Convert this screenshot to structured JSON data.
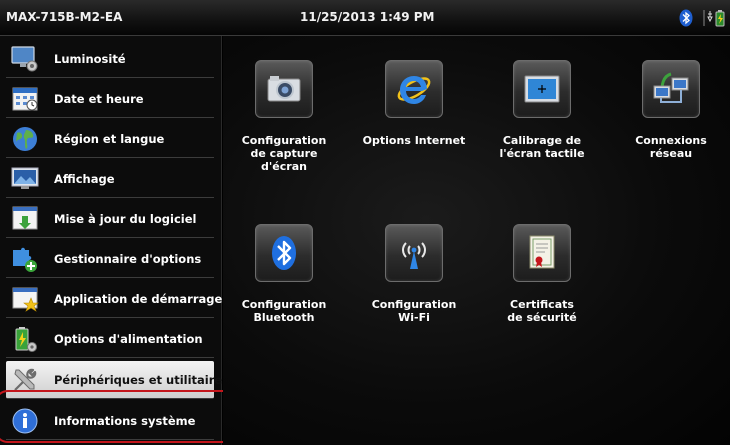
{
  "titlebar": {
    "device": "MAX-715B-M2-EA",
    "datetime": "11/25/2013 1:49 PM",
    "icons": [
      "bluetooth-icon",
      "power-battery-icon"
    ]
  },
  "sidebar": {
    "items": [
      {
        "label": "Luminosité",
        "icon": "monitor-brightness-icon"
      },
      {
        "label": "Date et heure",
        "icon": "calendar-icon"
      },
      {
        "label": "Région et langue",
        "icon": "globe-icon"
      },
      {
        "label": "Affichage",
        "icon": "display-icon"
      },
      {
        "label": "Mise à jour du logiciel",
        "icon": "software-update-icon"
      },
      {
        "label": "Gestionnaire d'options",
        "icon": "puzzle-options-icon"
      },
      {
        "label": "Application de démarrage",
        "icon": "startup-app-icon"
      },
      {
        "label": "Options d'alimentation",
        "icon": "battery-icon"
      },
      {
        "label": "Périphériques et utilitaires",
        "icon": "tools-icon",
        "selected": true
      },
      {
        "label": "Informations système",
        "icon": "info-icon"
      }
    ],
    "selected_color": "#e8e8e8",
    "highlight_color": "#c4161c"
  },
  "main": {
    "tiles": [
      {
        "label": "Configuration\nde capture\nd'écran",
        "icon": "camera-icon"
      },
      {
        "label": "Options Internet",
        "icon": "internet-explorer-icon"
      },
      {
        "label": "Calibrage de\nl'écran tactile",
        "icon": "touchscreen-calibration-icon"
      },
      {
        "label": "Connexions\nréseau",
        "icon": "network-icon"
      },
      {
        "label": "Configuration\nBluetooth",
        "icon": "bluetooth-icon"
      },
      {
        "label": "Configuration\nWi-Fi",
        "icon": "wifi-icon"
      },
      {
        "label": "Certificats\nde sécurité",
        "icon": "certificate-icon"
      }
    ]
  }
}
